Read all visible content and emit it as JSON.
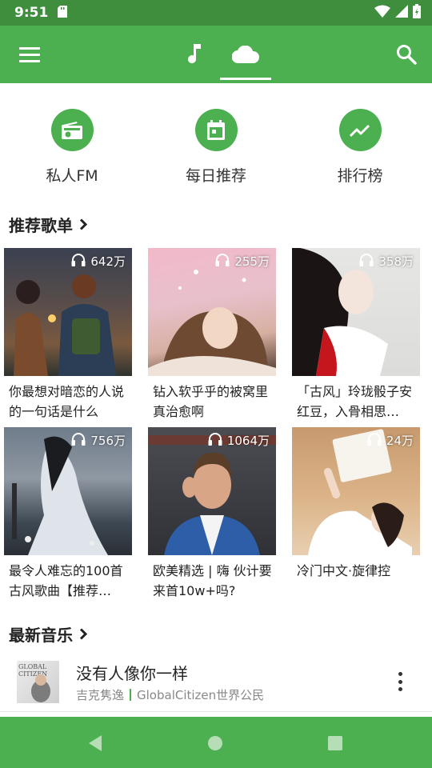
{
  "status_bar": {
    "time": "9:51"
  },
  "app_bar": {
    "icons": [
      "menu-icon",
      "music-note-icon",
      "cloud-icon",
      "search-icon"
    ],
    "active_tab": "cloud"
  },
  "quick_actions": [
    {
      "label": "私人FM",
      "icon": "radio-icon"
    },
    {
      "label": "每日推荐",
      "icon": "calendar-icon"
    },
    {
      "label": "排行榜",
      "icon": "trending-icon"
    }
  ],
  "sections": {
    "playlists_title": "推荐歌单",
    "new_music_title": "最新音乐"
  },
  "playlists": [
    {
      "count": "642万",
      "title": "你最想对暗恋的人说的一句话是什么"
    },
    {
      "count": "255万",
      "title": "钻入软乎乎的被窝里真治愈啊"
    },
    {
      "count": "358万",
      "title": "「古风」玲珑骰子安红豆，入骨相思…"
    },
    {
      "count": "756万",
      "title": "最令人难忘的100首古风歌曲【推荐…"
    },
    {
      "count": "1064万",
      "title": "欧美精选 | 嗨 伙计要来首10w+吗?"
    },
    {
      "count": "24万",
      "title": "冷门中文·旋律控"
    }
  ],
  "latest_song": {
    "cover_text": "GLOBAL CITIZEN",
    "title": "没有人像你一样",
    "artist": "吉克隽逸",
    "album": "GlobalCitizen世界公民"
  },
  "colors": {
    "primary": "#4caf50",
    "status_bar": "#3e8e3e"
  }
}
